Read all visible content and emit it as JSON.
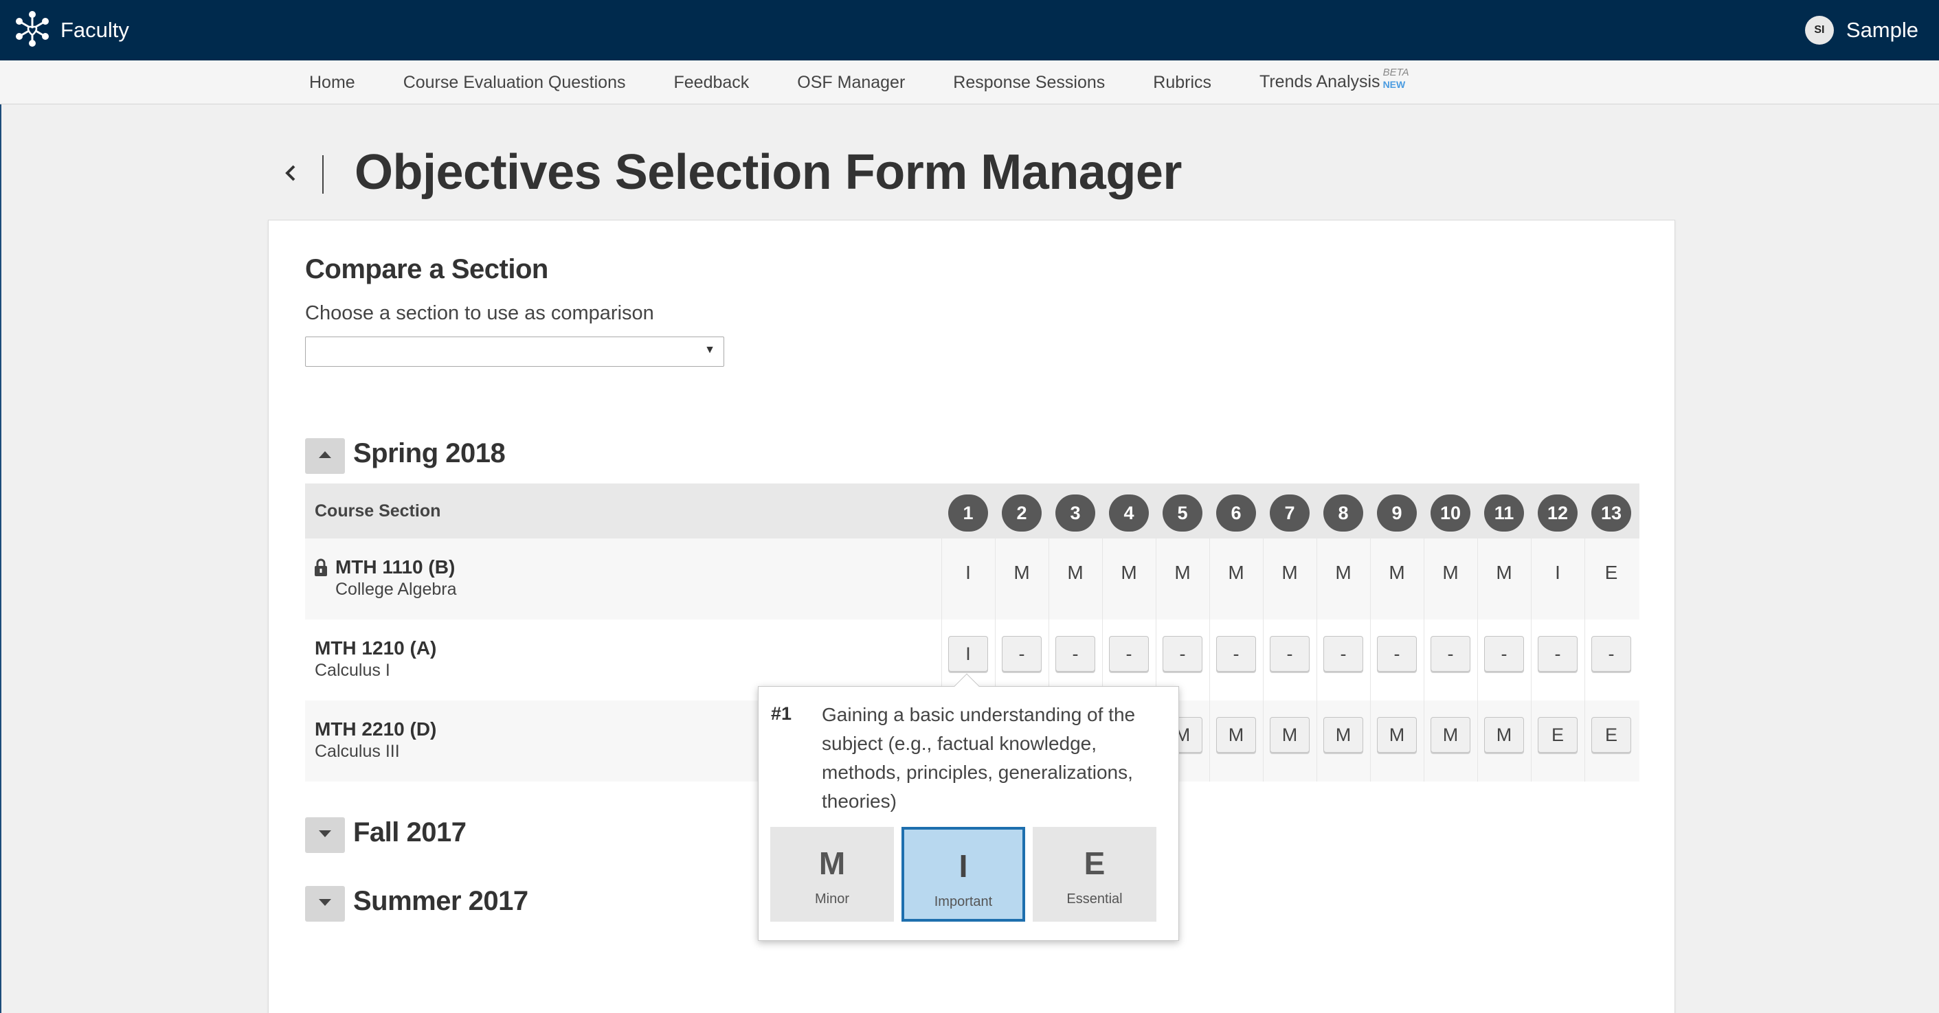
{
  "app": {
    "brand": "Faculty",
    "user": {
      "initials": "SI",
      "name": "Sample"
    }
  },
  "nav": {
    "items": [
      {
        "label": "Home"
      },
      {
        "label": "Course Evaluation Questions"
      },
      {
        "label": "Feedback"
      },
      {
        "label": "OSF Manager"
      },
      {
        "label": "Response Sessions"
      },
      {
        "label": "Rubrics"
      },
      {
        "label": "Trends Analysis",
        "badge_top": "BETA",
        "badge_bottom": "NEW"
      }
    ]
  },
  "page": {
    "back_icon": "chevron-left-icon",
    "title": "Objectives Selection Form Manager"
  },
  "compare": {
    "heading": "Compare a Section",
    "description": "Choose a section to use as comparison",
    "selected_value": "",
    "arrow": "▼"
  },
  "terms": [
    {
      "title": "Spring 2018",
      "expanded": true,
      "toggle_icon": "caret-up-icon"
    },
    {
      "title": "Fall 2017",
      "expanded": false,
      "toggle_icon": "caret-down-icon"
    },
    {
      "title": "Summer 2017",
      "expanded": false,
      "toggle_icon": "caret-down-icon"
    }
  ],
  "table": {
    "column_title": "Course Section",
    "objective_numbers": [
      "1",
      "2",
      "3",
      "4",
      "5",
      "6",
      "7",
      "8",
      "9",
      "10",
      "11",
      "12",
      "13"
    ],
    "rows": [
      {
        "code": "MTH 1110 (B)",
        "name": "College Algebra",
        "locked": true,
        "values": [
          "I",
          "M",
          "M",
          "M",
          "M",
          "M",
          "M",
          "M",
          "M",
          "M",
          "M",
          "I",
          "E"
        ]
      },
      {
        "code": "MTH 1210 (A)",
        "name": "Calculus I",
        "locked": false,
        "values": [
          "I",
          "-",
          "-",
          "-",
          "-",
          "-",
          "-",
          "-",
          "-",
          "-",
          "-",
          "-",
          "-"
        ]
      },
      {
        "code": "MTH 2210 (D)",
        "name": "Calculus III",
        "locked": false,
        "values": [
          "",
          "",
          "",
          "",
          "M",
          "M",
          "M",
          "M",
          "M",
          "M",
          "M",
          "E",
          "E"
        ]
      }
    ]
  },
  "popover": {
    "number": "#1",
    "text": "Gaining a basic understanding of the subject (e.g., factual knowledge, methods, principles, generalizations, theories)",
    "options": [
      {
        "letter": "M",
        "label": "Minor",
        "selected": false
      },
      {
        "letter": "I",
        "label": "Important",
        "selected": true
      },
      {
        "letter": "E",
        "label": "Essential",
        "selected": false
      }
    ]
  },
  "colors": {
    "topbar": "#002a4d",
    "selected_option_bg": "#b8d8ef",
    "selected_option_border": "#1e6fae",
    "number_circle": "#585858"
  }
}
